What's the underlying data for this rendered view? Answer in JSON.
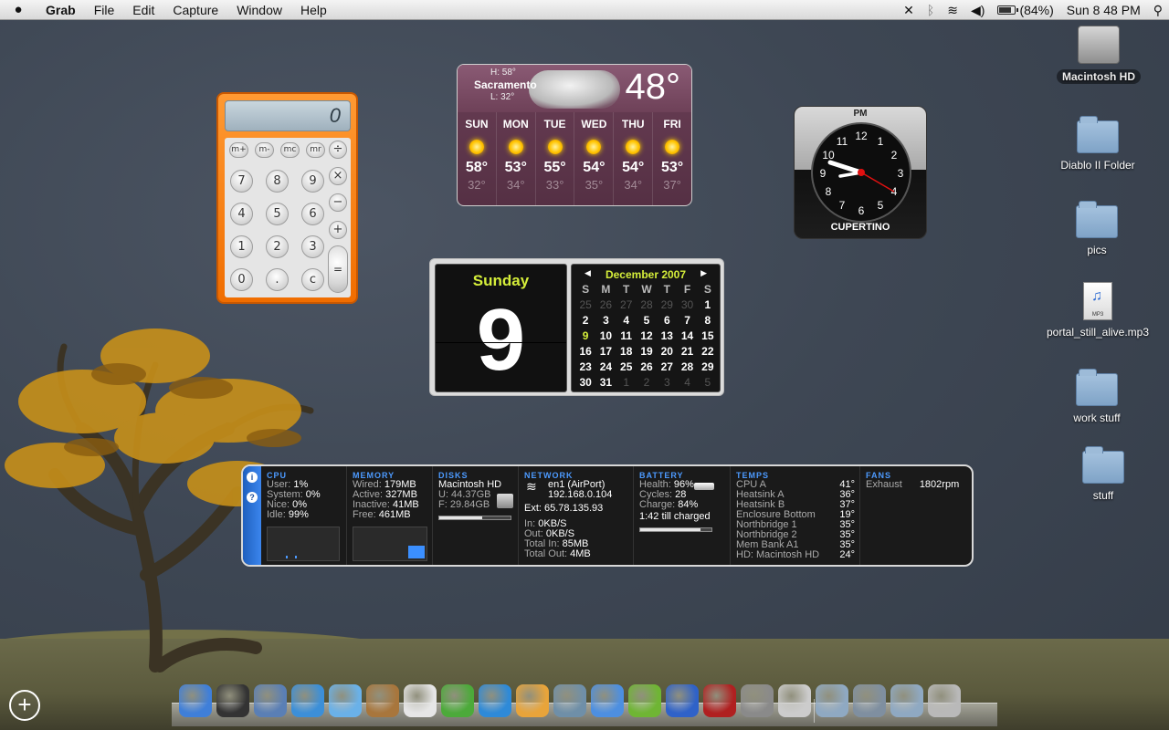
{
  "menubar": {
    "app_name": "Grab",
    "items": [
      "File",
      "Edit",
      "Capture",
      "Window",
      "Help"
    ],
    "battery_percent": "(84%)",
    "battery_level": 0.84,
    "clock": "Sun 8 48 PM"
  },
  "calculator": {
    "display": "0",
    "memory_keys": [
      "m+",
      "m-",
      "mc",
      "mr"
    ],
    "divide": "÷",
    "multiply": "×",
    "minus": "−",
    "plus": "+",
    "equals": "=",
    "digits": [
      "7",
      "8",
      "9",
      "4",
      "5",
      "6",
      "1",
      "2",
      "3",
      "0",
      ".",
      "c"
    ]
  },
  "weather": {
    "city": "Sacramento",
    "hi": "H: 58°",
    "lo": "L: 32°",
    "current": "48°",
    "days": [
      {
        "name": "SUN",
        "hi": "58°",
        "lo": "32°"
      },
      {
        "name": "MON",
        "hi": "53°",
        "lo": "34°"
      },
      {
        "name": "TUE",
        "hi": "55°",
        "lo": "33°"
      },
      {
        "name": "WED",
        "hi": "54°",
        "lo": "35°"
      },
      {
        "name": "THU",
        "hi": "54°",
        "lo": "34°"
      },
      {
        "name": "FRI",
        "hi": "53°",
        "lo": "37°"
      }
    ]
  },
  "clock_widget": {
    "period": "PM",
    "city": "CUPERTINO",
    "numbers": [
      "12",
      "1",
      "2",
      "3",
      "4",
      "5",
      "6",
      "7",
      "8",
      "9",
      "10",
      "11"
    ]
  },
  "calendar": {
    "day_name": "Sunday",
    "day_number": "9",
    "month": "December 2007",
    "prev": "◀",
    "next": "▶",
    "weekday_headers": [
      "S",
      "M",
      "T",
      "W",
      "T",
      "F",
      "S"
    ],
    "cells": [
      [
        "25",
        "dim"
      ],
      [
        "26",
        "dim"
      ],
      [
        "27",
        "dim"
      ],
      [
        "28",
        "dim"
      ],
      [
        "29",
        "dim"
      ],
      [
        "30",
        "dim"
      ],
      [
        "1",
        ""
      ],
      [
        "2",
        ""
      ],
      [
        "3",
        ""
      ],
      [
        "4",
        ""
      ],
      [
        "5",
        ""
      ],
      [
        "6",
        ""
      ],
      [
        "7",
        ""
      ],
      [
        "8",
        ""
      ],
      [
        "9",
        "today"
      ],
      [
        "10",
        ""
      ],
      [
        "11",
        ""
      ],
      [
        "12",
        ""
      ],
      [
        "13",
        ""
      ],
      [
        "14",
        ""
      ],
      [
        "15",
        ""
      ],
      [
        "16",
        ""
      ],
      [
        "17",
        ""
      ],
      [
        "18",
        ""
      ],
      [
        "19",
        ""
      ],
      [
        "20",
        ""
      ],
      [
        "21",
        ""
      ],
      [
        "22",
        ""
      ],
      [
        "23",
        ""
      ],
      [
        "24",
        ""
      ],
      [
        "25",
        ""
      ],
      [
        "26",
        ""
      ],
      [
        "27",
        ""
      ],
      [
        "28",
        ""
      ],
      [
        "29",
        ""
      ],
      [
        "30",
        ""
      ],
      [
        "31",
        ""
      ],
      [
        "1",
        "dim"
      ],
      [
        "2",
        "dim"
      ],
      [
        "3",
        "dim"
      ],
      [
        "4",
        "dim"
      ],
      [
        "5",
        "dim"
      ]
    ]
  },
  "istat": {
    "info_button": "i",
    "help_button": "?",
    "cpu": {
      "title": "CPU",
      "rows": [
        [
          "User:",
          "1%"
        ],
        [
          "System:",
          "0%"
        ],
        [
          "Nice:",
          "0%"
        ],
        [
          "Idle:",
          "99%"
        ]
      ]
    },
    "memory": {
      "title": "MEMORY",
      "rows": [
        [
          "Wired:",
          "179MB"
        ],
        [
          "Active:",
          "327MB"
        ],
        [
          "Inactive:",
          "41MB"
        ],
        [
          "Free:",
          "461MB"
        ]
      ]
    },
    "disks": {
      "title": "DISKS",
      "name": "Macintosh HD",
      "used": "U: 44.37GB",
      "free": "F: 29.84GB",
      "used_fraction": 0.6
    },
    "network": {
      "title": "NETWORK",
      "interface": "en1 (AirPort)",
      "ip": "192.168.0.104",
      "ext": "Ext: 65.78.135.93",
      "rows": [
        [
          "In:",
          "0KB/S"
        ],
        [
          "Out:",
          "0KB/S"
        ],
        [
          "Total In:",
          "85MB"
        ],
        [
          "Total Out:",
          "4MB"
        ]
      ]
    },
    "battery": {
      "title": "BATTERY",
      "rows": [
        [
          "Health:",
          "96%"
        ],
        [
          "Cycles:",
          "28"
        ],
        [
          "Charge:",
          "84%"
        ]
      ],
      "status": "1:42 till charged",
      "charge_fraction": 0.84
    },
    "temps": {
      "title": "TEMPS",
      "rows": [
        [
          "CPU A",
          "41°"
        ],
        [
          "Heatsink A",
          "36°"
        ],
        [
          "Heatsink B",
          "37°"
        ],
        [
          "Enclosure Bottom",
          "19°"
        ],
        [
          "Northbridge 1",
          "35°"
        ],
        [
          "Northbridge 2",
          "35°"
        ],
        [
          "Mem Bank A1",
          "35°"
        ],
        [
          "HD: Macintosh HD",
          "24°"
        ]
      ]
    },
    "fans": {
      "title": "FANS",
      "label": "Exhaust",
      "value": "1802rpm"
    }
  },
  "desktop_icons": [
    {
      "label": "Macintosh HD",
      "kind": "hd"
    },
    {
      "label": "Diablo II Folder",
      "kind": "folder"
    },
    {
      "label": "pics",
      "kind": "folder"
    },
    {
      "label": "portal_still_alive.mp3",
      "kind": "mp3",
      "badge": "MP3"
    },
    {
      "label": "work stuff",
      "kind": "folder"
    },
    {
      "label": "stuff",
      "kind": "folder"
    }
  ],
  "dock": {
    "add_widget": "+",
    "icons": [
      {
        "name": "finder-icon",
        "color": "#3f7fd9"
      },
      {
        "name": "dashboard-icon",
        "color": "#333333"
      },
      {
        "name": "mail-stamp-icon",
        "color": "#5a7fb5"
      },
      {
        "name": "safari-icon",
        "color": "#3c8fd8"
      },
      {
        "name": "itunes-icon",
        "color": "#6ab1e8"
      },
      {
        "name": "address-book-icon",
        "color": "#a8763c"
      },
      {
        "name": "ical-icon",
        "color": "#e6e6e6"
      },
      {
        "name": "app-green-icon",
        "color": "#4caa3a"
      },
      {
        "name": "app-blue-w-icon",
        "color": "#2e8ad8"
      },
      {
        "name": "adium-icon",
        "color": "#e8a43a"
      },
      {
        "name": "iphoto-icon",
        "color": "#6f8fa8"
      },
      {
        "name": "ichat-icon",
        "color": "#4d8fe0"
      },
      {
        "name": "limewire-icon",
        "color": "#6fb534"
      },
      {
        "name": "frog-icon",
        "color": "#2f62c8"
      },
      {
        "name": "photo-booth-icon",
        "color": "#b02020"
      },
      {
        "name": "system-preferences-icon",
        "color": "#8a8a8a"
      },
      {
        "name": "script-editor-icon",
        "color": "#cccccc"
      },
      {
        "name": "downloads-stack-icon",
        "color": "#8fa9c2"
      },
      {
        "name": "documents-stack-icon",
        "color": "#7f8fa0"
      },
      {
        "name": "folder-stack-icon",
        "color": "#8fa9c2"
      },
      {
        "name": "trash-icon",
        "color": "#b9b9b9"
      }
    ]
  }
}
